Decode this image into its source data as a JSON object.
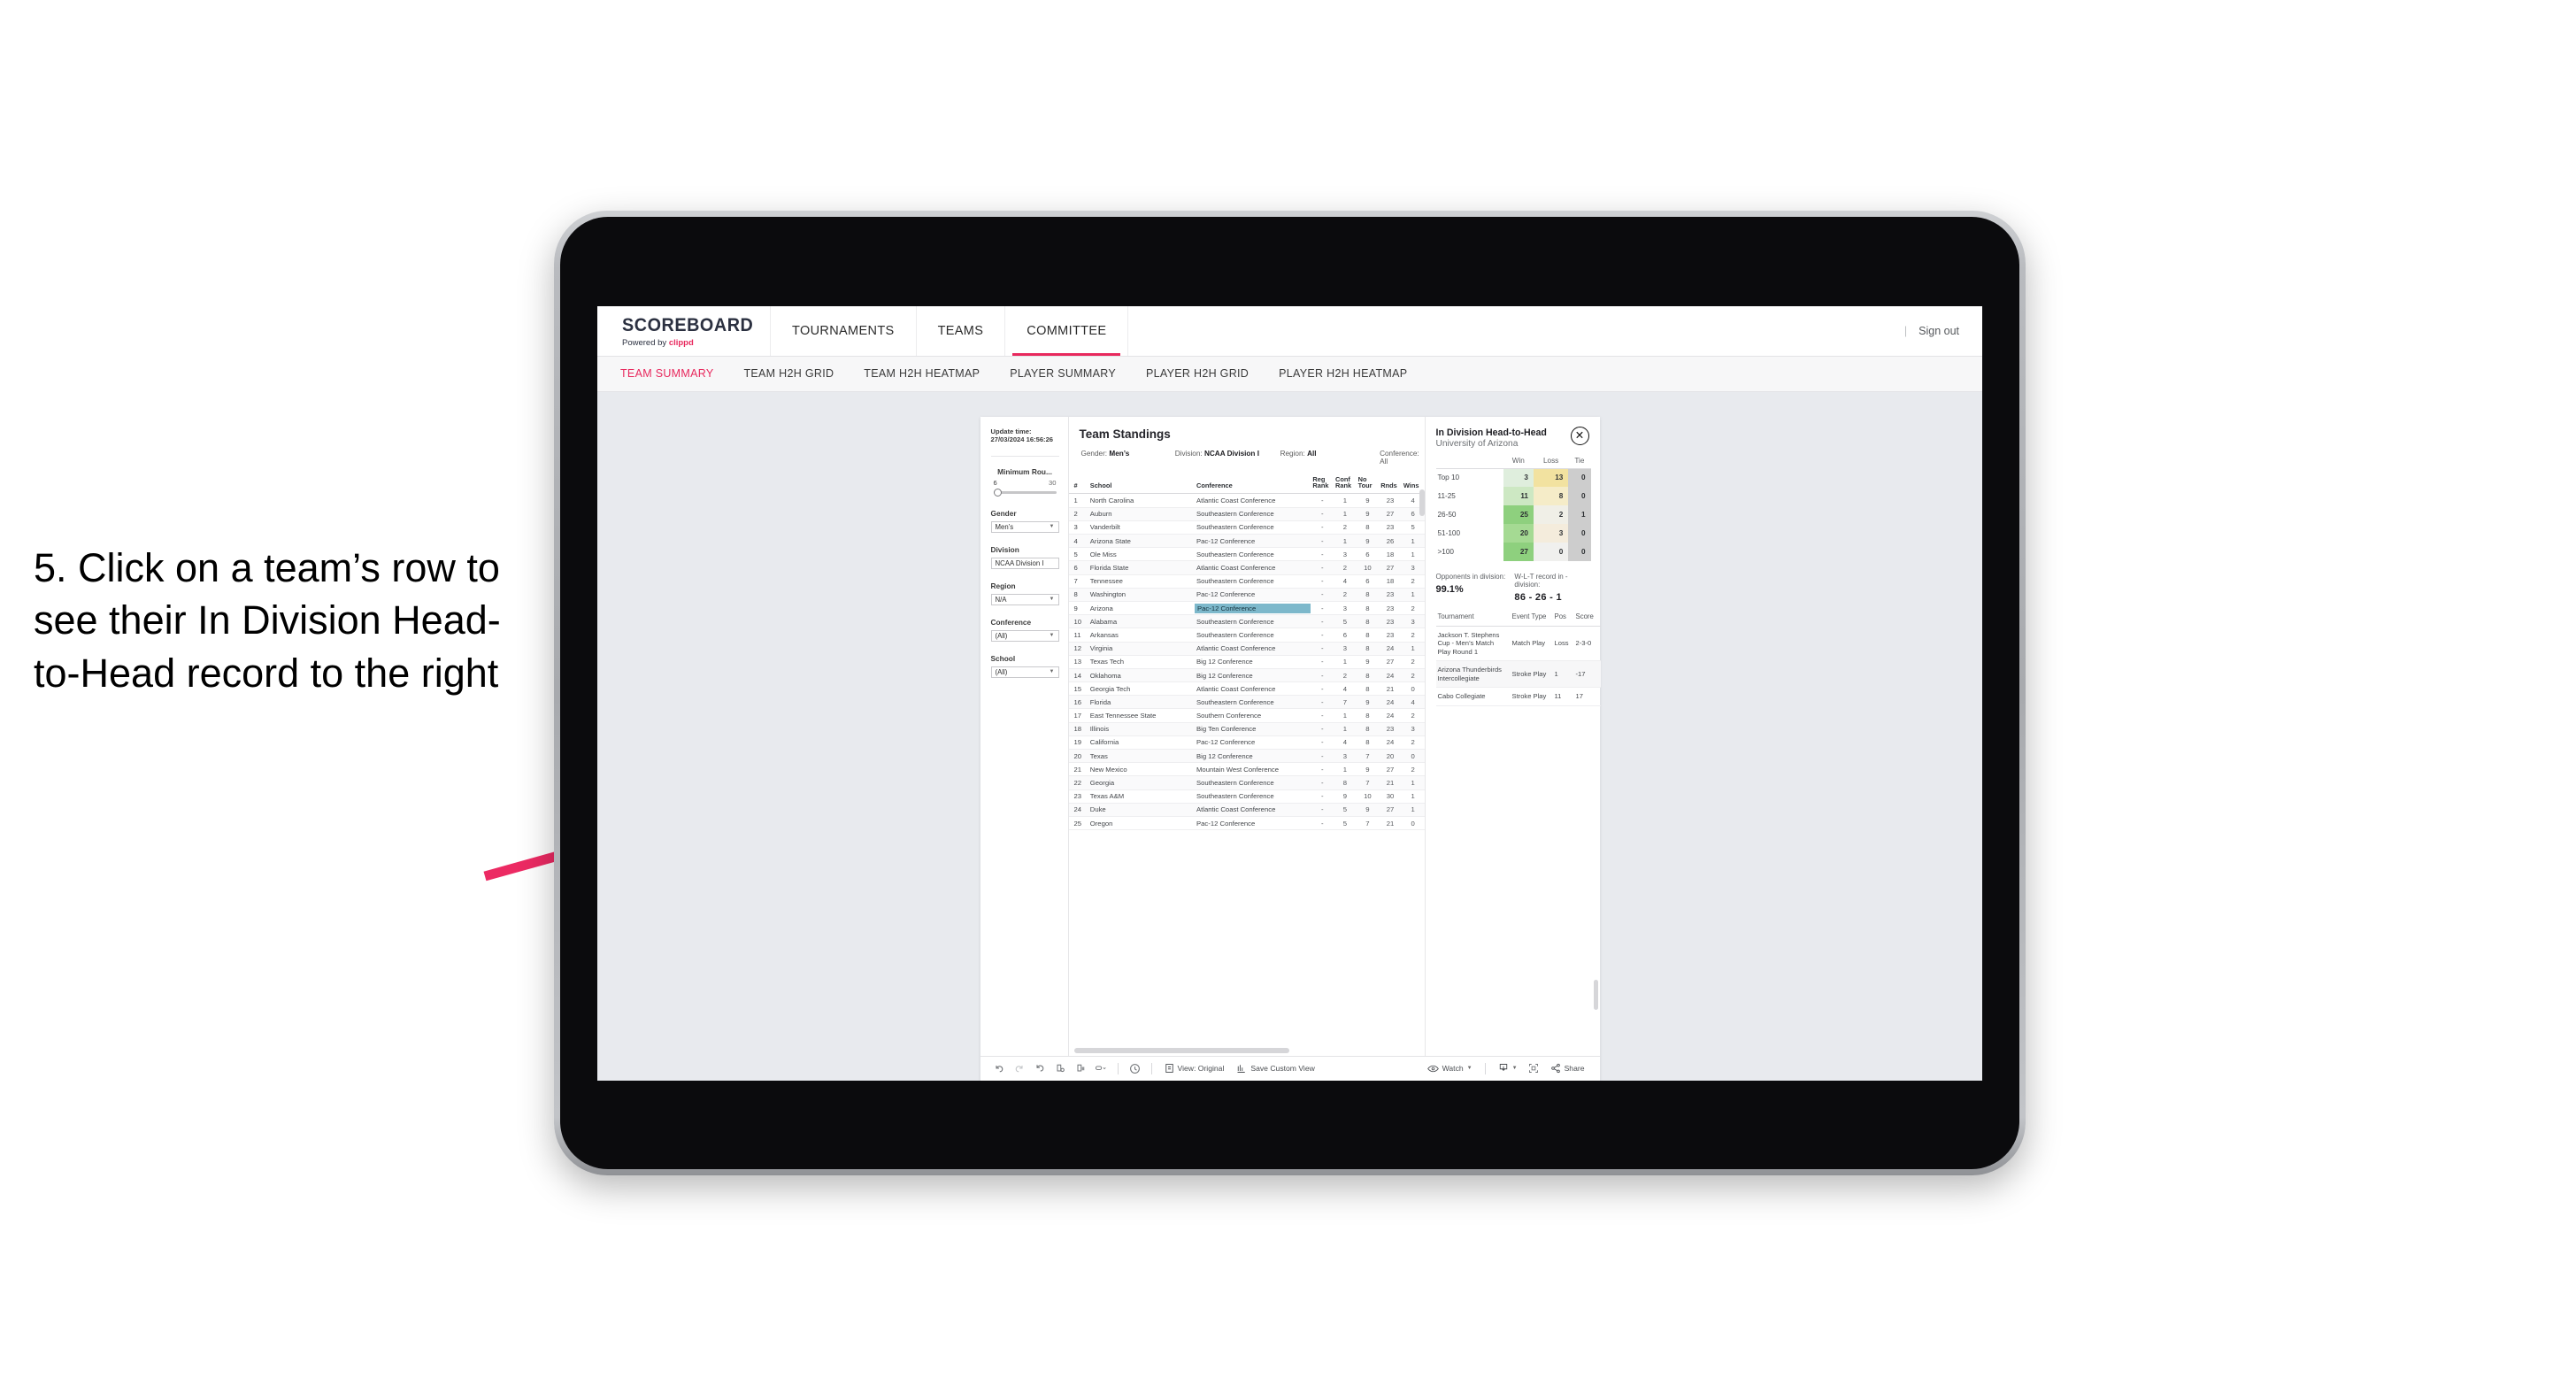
{
  "annotation": {
    "text": "5. Click on a team’s row to see their In Division Head-to-Head record to the right",
    "arrow_color": "#ec2a63"
  },
  "header": {
    "brand_name": "SCOREBOARD",
    "brand_sub_prefix": "Powered by ",
    "brand_sub_highlight": "clippd",
    "nav": [
      {
        "label": "TOURNAMENTS",
        "active": false
      },
      {
        "label": "TEAMS",
        "active": false
      },
      {
        "label": "COMMITTEE",
        "active": true
      }
    ],
    "sign_out": "Sign out",
    "divider": "|"
  },
  "subnav": {
    "items": [
      {
        "label": "TEAM SUMMARY",
        "active": true
      },
      {
        "label": "TEAM H2H GRID",
        "active": false
      },
      {
        "label": "TEAM H2H HEATMAP",
        "active": false
      },
      {
        "label": "PLAYER SUMMARY",
        "active": false
      },
      {
        "label": "PLAYER H2H GRID",
        "active": false
      },
      {
        "label": "PLAYER H2H HEATMAP",
        "active": false
      }
    ]
  },
  "filters": {
    "update_label": "Update time:",
    "update_time": "27/03/2024 16:56:26",
    "slider": {
      "title": "Minimum Rou...",
      "min": "6",
      "max": "30"
    },
    "groups": [
      {
        "label": "Gender",
        "value": "Men’s"
      },
      {
        "label": "Division",
        "value": "NCAA Division I"
      },
      {
        "label": "Region",
        "value": "N/A"
      },
      {
        "label": "Conference",
        "value": "(All)"
      },
      {
        "label": "School",
        "value": "(All)"
      }
    ]
  },
  "standings": {
    "title": "Team Standings",
    "filter_summary": [
      {
        "label": "Gender:",
        "value": "Men’s"
      },
      {
        "label": "Division:",
        "value": "NCAA Division I"
      },
      {
        "label": "Region:",
        "value": "All"
      },
      {
        "label": "Conference:",
        "value": "All"
      }
    ],
    "columns": [
      "#",
      "School",
      "Conference",
      "Reg Rank",
      "Conf Rank",
      "No Tour",
      "Rnds",
      "Wins"
    ],
    "columns_wrapped": [
      {
        "l1": "#",
        "l2": ""
      },
      {
        "l1": "School",
        "l2": ""
      },
      {
        "l1": "Conference",
        "l2": ""
      },
      {
        "l1": "Reg",
        "l2": "Rank"
      },
      {
        "l1": "Conf",
        "l2": "Rank"
      },
      {
        "l1": "No",
        "l2": "Tour"
      },
      {
        "l1": "Rnds",
        "l2": ""
      },
      {
        "l1": "Wins",
        "l2": ""
      }
    ],
    "selected_row": 9,
    "highlight_color": "#7db8cb",
    "rows": [
      {
        "n": "1",
        "school": "North Carolina",
        "conf": "Atlantic Coast Conference",
        "reg": "-",
        "crank": "1",
        "notour": "9",
        "rnds": "23",
        "wins": "4"
      },
      {
        "n": "2",
        "school": "Auburn",
        "conf": "Southeastern Conference",
        "reg": "-",
        "crank": "1",
        "notour": "9",
        "rnds": "27",
        "wins": "6"
      },
      {
        "n": "3",
        "school": "Vanderbilt",
        "conf": "Southeastern Conference",
        "reg": "-",
        "crank": "2",
        "notour": "8",
        "rnds": "23",
        "wins": "5"
      },
      {
        "n": "4",
        "school": "Arizona State",
        "conf": "Pac-12 Conference",
        "reg": "-",
        "crank": "1",
        "notour": "9",
        "rnds": "26",
        "wins": "1"
      },
      {
        "n": "5",
        "school": "Ole Miss",
        "conf": "Southeastern Conference",
        "reg": "-",
        "crank": "3",
        "notour": "6",
        "rnds": "18",
        "wins": "1"
      },
      {
        "n": "6",
        "school": "Florida State",
        "conf": "Atlantic Coast Conference",
        "reg": "-",
        "crank": "2",
        "notour": "10",
        "rnds": "27",
        "wins": "3"
      },
      {
        "n": "7",
        "school": "Tennessee",
        "conf": "Southeastern Conference",
        "reg": "-",
        "crank": "4",
        "notour": "6",
        "rnds": "18",
        "wins": "2"
      },
      {
        "n": "8",
        "school": "Washington",
        "conf": "Pac-12 Conference",
        "reg": "-",
        "crank": "2",
        "notour": "8",
        "rnds": "23",
        "wins": "1"
      },
      {
        "n": "9",
        "school": "Arizona",
        "conf": "Pac-12 Conference",
        "reg": "-",
        "crank": "3",
        "notour": "8",
        "rnds": "23",
        "wins": "2"
      },
      {
        "n": "10",
        "school": "Alabama",
        "conf": "Southeastern Conference",
        "reg": "-",
        "crank": "5",
        "notour": "8",
        "rnds": "23",
        "wins": "3"
      },
      {
        "n": "11",
        "school": "Arkansas",
        "conf": "Southeastern Conference",
        "reg": "-",
        "crank": "6",
        "notour": "8",
        "rnds": "23",
        "wins": "2"
      },
      {
        "n": "12",
        "school": "Virginia",
        "conf": "Atlantic Coast Conference",
        "reg": "-",
        "crank": "3",
        "notour": "8",
        "rnds": "24",
        "wins": "1"
      },
      {
        "n": "13",
        "school": "Texas Tech",
        "conf": "Big 12 Conference",
        "reg": "-",
        "crank": "1",
        "notour": "9",
        "rnds": "27",
        "wins": "2"
      },
      {
        "n": "14",
        "school": "Oklahoma",
        "conf": "Big 12 Conference",
        "reg": "-",
        "crank": "2",
        "notour": "8",
        "rnds": "24",
        "wins": "2"
      },
      {
        "n": "15",
        "school": "Georgia Tech",
        "conf": "Atlantic Coast Conference",
        "reg": "-",
        "crank": "4",
        "notour": "8",
        "rnds": "21",
        "wins": "0"
      },
      {
        "n": "16",
        "school": "Florida",
        "conf": "Southeastern Conference",
        "reg": "-",
        "crank": "7",
        "notour": "9",
        "rnds": "24",
        "wins": "4"
      },
      {
        "n": "17",
        "school": "East Tennessee State",
        "conf": "Southern Conference",
        "reg": "-",
        "crank": "1",
        "notour": "8",
        "rnds": "24",
        "wins": "2"
      },
      {
        "n": "18",
        "school": "Illinois",
        "conf": "Big Ten Conference",
        "reg": "-",
        "crank": "1",
        "notour": "8",
        "rnds": "23",
        "wins": "3"
      },
      {
        "n": "19",
        "school": "California",
        "conf": "Pac-12 Conference",
        "reg": "-",
        "crank": "4",
        "notour": "8",
        "rnds": "24",
        "wins": "2"
      },
      {
        "n": "20",
        "school": "Texas",
        "conf": "Big 12 Conference",
        "reg": "-",
        "crank": "3",
        "notour": "7",
        "rnds": "20",
        "wins": "0"
      },
      {
        "n": "21",
        "school": "New Mexico",
        "conf": "Mountain West Conference",
        "reg": "-",
        "crank": "1",
        "notour": "9",
        "rnds": "27",
        "wins": "2"
      },
      {
        "n": "22",
        "school": "Georgia",
        "conf": "Southeastern Conference",
        "reg": "-",
        "crank": "8",
        "notour": "7",
        "rnds": "21",
        "wins": "1"
      },
      {
        "n": "23",
        "school": "Texas A&M",
        "conf": "Southeastern Conference",
        "reg": "-",
        "crank": "9",
        "notour": "10",
        "rnds": "30",
        "wins": "1"
      },
      {
        "n": "24",
        "school": "Duke",
        "conf": "Atlantic Coast Conference",
        "reg": "-",
        "crank": "5",
        "notour": "9",
        "rnds": "27",
        "wins": "1"
      },
      {
        "n": "25",
        "school": "Oregon",
        "conf": "Pac-12 Conference",
        "reg": "-",
        "crank": "5",
        "notour": "7",
        "rnds": "21",
        "wins": "0"
      }
    ]
  },
  "h2h": {
    "title": "In Division Head-to-Head",
    "subtitle": "University of Arizona",
    "close_icon": "close-icon",
    "matrix": {
      "columns": [
        "Win",
        "Loss",
        "Tie"
      ],
      "rows": [
        {
          "label": "Top 10",
          "win": "3",
          "loss": "13",
          "tie": "0",
          "win_color": "#dfeedd",
          "loss_color": "#f2e2a0",
          "tie_color": "#cdcdcd"
        },
        {
          "label": "11-25",
          "win": "11",
          "loss": "8",
          "tie": "0",
          "win_color": "#cde8c3",
          "loss_color": "#f5ecc8",
          "tie_color": "#cdcdcd"
        },
        {
          "label": "26-50",
          "win": "25",
          "loss": "2",
          "tie": "1",
          "win_color": "#8ed07e",
          "loss_color": "#f0efe7",
          "tie_color": "#cdcdcd"
        },
        {
          "label": "51-100",
          "win": "20",
          "loss": "3",
          "tie": "0",
          "win_color": "#a5da93",
          "loss_color": "#f4ecdc",
          "tie_color": "#cdcdcd"
        },
        {
          "label": ">100",
          "win": "27",
          "loss": "0",
          "tie": "0",
          "win_color": "#8ed07e",
          "loss_color": "#f0f0ee",
          "tie_color": "#cdcdcd"
        }
      ]
    },
    "stats": [
      {
        "label": "Opponents in division:",
        "value": "99.1%"
      },
      {
        "label": "W-L-T record in -division:",
        "value": "86 - 26 - 1"
      }
    ],
    "tournaments": {
      "columns": [
        "Tournament",
        "Event Type",
        "Pos",
        "Score"
      ],
      "rows": [
        {
          "name": "Jackson T. Stephens Cup - Men’s Match Play Round 1",
          "type": "Match Play",
          "pos": "Loss",
          "score": "2-3-0"
        },
        {
          "name": "Arizona Thunderbirds Intercollegiate",
          "type": "Stroke Play",
          "pos": "1",
          "score": "-17"
        },
        {
          "name": "Cabo Collegiate",
          "type": "Stroke Play",
          "pos": "11",
          "score": "17"
        }
      ]
    }
  },
  "toolbar": {
    "icons": [
      "undo-icon",
      "redo-icon",
      "revert-icon",
      "refresh-data-icon",
      "pause-updates-icon",
      "view-mode-icon"
    ],
    "alerts_icon": "alerts-icon",
    "view_label": "View: Original",
    "view_icon": "view-original-icon",
    "save_label": "Save Custom View",
    "save_icon": "save-custom-view-icon",
    "watch_label": "Watch",
    "watch_icon": "eye-icon",
    "download_icon": "download-icon",
    "fullscreen_icon": "fullscreen-icon",
    "share_label": "Share",
    "share_icon": "share-icon"
  }
}
